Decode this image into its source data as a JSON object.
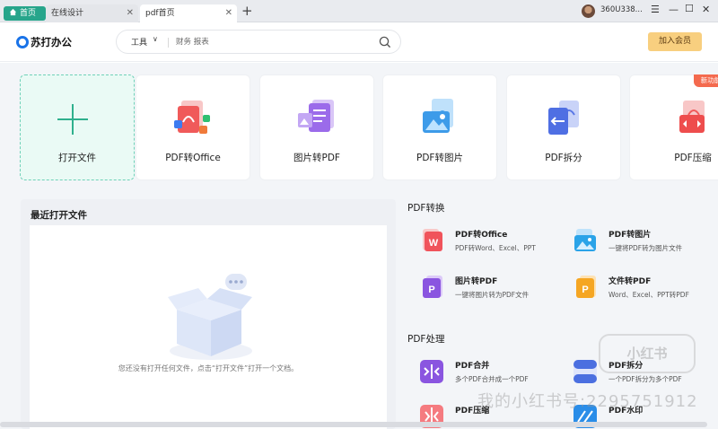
{
  "tabs": [
    {
      "label": "首页",
      "active": false
    },
    {
      "label": "在线设计",
      "active": false
    },
    {
      "label": "pdf首页",
      "active": true
    }
  ],
  "user": {
    "name": "360U338..."
  },
  "header": {
    "logo_text": "苏打办公",
    "search_type": "工具",
    "search_placeholder": "财务 报表",
    "member_button": "加入会员"
  },
  "quick_actions": [
    {
      "label": "打开文件",
      "icon": "plus-icon"
    },
    {
      "label": "PDF转Office",
      "icon": "pdf-to-office-icon"
    },
    {
      "label": "图片转PDF",
      "icon": "image-to-pdf-icon"
    },
    {
      "label": "PDF转图片",
      "icon": "pdf-to-image-icon"
    },
    {
      "label": "PDF拆分",
      "icon": "pdf-split-icon"
    },
    {
      "label": "PDF压缩",
      "icon": "pdf-compress-icon",
      "badge": "新功能"
    }
  ],
  "recent": {
    "title": "最近打开文件",
    "empty_text": "您还没有打开任何文件，点击“打开文件”打开一个文档。"
  },
  "pdf_convert": {
    "title": "PDF转换",
    "tools": [
      {
        "name": "PDF转Office",
        "desc": "PDF转Word、Excel、PPT",
        "color": "#f0535b"
      },
      {
        "name": "PDF转图片",
        "desc": "一键将PDF转为图片文件",
        "color": "#2aa3e8"
      },
      {
        "name": "图片转PDF",
        "desc": "一键将图片转为PDF文件",
        "color": "#8a55e0"
      },
      {
        "name": "文件转PDF",
        "desc": "Word、Excel、PPT转PDF",
        "color": "#f5a623"
      }
    ]
  },
  "pdf_process": {
    "title": "PDF处理",
    "tools": [
      {
        "name": "PDF合并",
        "desc": "多个PDF合并成一个PDF",
        "color": "#8a55e0"
      },
      {
        "name": "PDF拆分",
        "desc": "一个PDF拆分为多个PDF",
        "color": "#4b6fe0"
      },
      {
        "name": "PDF压缩",
        "desc": "",
        "color": "#f0535b"
      },
      {
        "name": "PDF水印",
        "desc": "",
        "color": "#2a8de8"
      }
    ]
  },
  "watermark": {
    "text": "我的小红书号:2295751912",
    "logo": "小红书"
  }
}
